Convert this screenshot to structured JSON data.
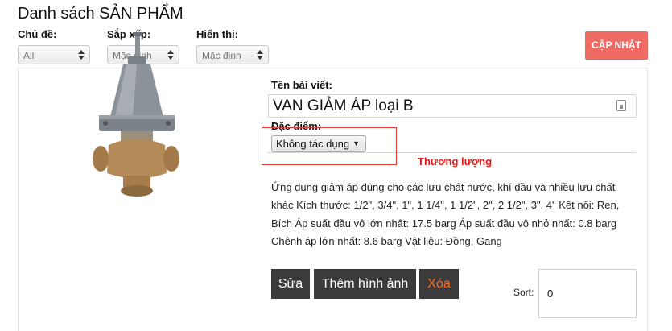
{
  "page": {
    "title": "Danh sách SẢN PHẨM"
  },
  "filters": [
    {
      "label": "Chủ đề:",
      "value": "All"
    },
    {
      "label": "Sắp xếp:",
      "value": "Mặc định"
    },
    {
      "label": "Hiển thị:",
      "value": "Mặc định"
    }
  ],
  "update_button": {
    "label": "CẬP NHẬT",
    "color": "#ef6a63"
  },
  "product": {
    "post_label": "Tên bài viết:",
    "post_title": "VAN GIẢM ÁP loại B",
    "feature_label": "Đặc điểm:",
    "feature_value": "Không tác dụng",
    "price_text": "Thương lượng",
    "description": "Ứng dụng giảm áp dùng cho các lưu chất nước, khí dầu và nhiều lưu chất khác Kích thước: 1/2\", 3/4\", 1\", 1 1/4\", 1 1/2\", 2\", 2 1/2\", 3\", 4\" Kết nối: Ren, Bích Áp suất đầu vô lớn nhất: 17.5 barg Áp suất đầu vô nhỏ nhất: 0.8 barg Chênh áp lớn nhất: 8.6 barg Vật liệu: Đồng, Gang"
  },
  "actions": {
    "edit": "Sửa",
    "add_image": "Thêm hình ảnh",
    "delete": "Xóa"
  },
  "sort": {
    "label": "Sort:",
    "value": "0"
  },
  "icons": {
    "select_arrows": "select-arrows-icon",
    "clip": "clipboard-icon",
    "dropdown": "triangle-down-icon"
  },
  "colors": {
    "accent_red": "#e31b1b",
    "highlight_box": "#e23b3b",
    "button_dark": "#3b3b3b",
    "delete_text": "#ff6a1a"
  }
}
